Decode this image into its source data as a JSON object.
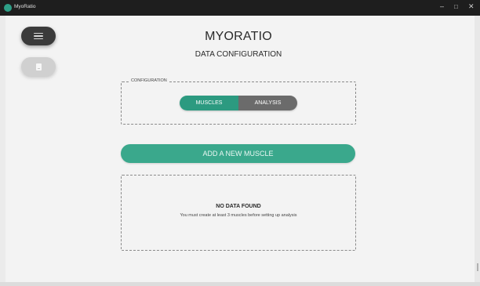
{
  "window": {
    "title": "MyoRatio",
    "icon": "app-logo-icon",
    "controls": {
      "minimize": "–",
      "maximize": "□",
      "close": "✕"
    }
  },
  "sidebar": {
    "menu_icon": "hamburger-icon",
    "doc_icon": "document-icon"
  },
  "header": {
    "title": "MYORATIO",
    "subtitle": "DATA CONFIGURATION"
  },
  "configuration": {
    "legend": "CONFIGURATION",
    "options": [
      "MUSCLES",
      "ANALYSIS"
    ],
    "selected": "MUSCLES"
  },
  "add_button": {
    "label": "ADD A NEW MUSCLE"
  },
  "empty_state": {
    "title": "NO DATA FOUND",
    "message": "You must create at least 3 muscles before setting up analysis"
  },
  "colors": {
    "accent": "#3aa88c",
    "toggle_active": "#2c9a80",
    "toggle_inactive": "#6b6b6b",
    "titlebar": "#1e1e1e",
    "menu_button": "#3b3b3b"
  }
}
